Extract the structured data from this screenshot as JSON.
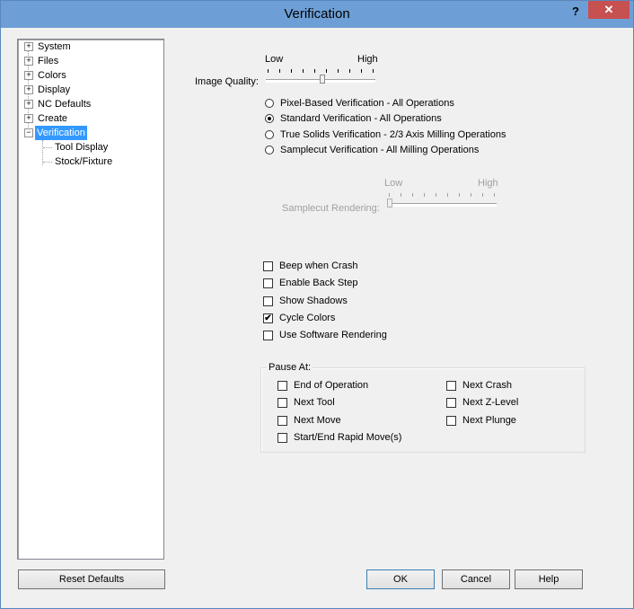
{
  "window": {
    "title": "Verification",
    "help_symbol": "?",
    "close_symbol": "✕"
  },
  "tree": {
    "items": [
      {
        "label": "System",
        "expander": "+"
      },
      {
        "label": "Files",
        "expander": "+"
      },
      {
        "label": "Colors",
        "expander": "+"
      },
      {
        "label": "Display",
        "expander": "+"
      },
      {
        "label": "NC Defaults",
        "expander": "+"
      },
      {
        "label": "Create",
        "expander": "+"
      },
      {
        "label": "Verification",
        "expander": "−",
        "selected": true
      },
      {
        "label": "Tool Display"
      },
      {
        "label": "Stock/Fixture"
      }
    ]
  },
  "image_quality": {
    "label": "Image Quality:",
    "low": "Low",
    "high": "High",
    "level_fraction": 0.5
  },
  "verification_modes": [
    {
      "label": "Pixel-Based Verification - All Operations",
      "selected": false
    },
    {
      "label": "Standard Verification - All Operations",
      "selected": true
    },
    {
      "label": "True Solids Verification - 2/3 Axis Milling Operations",
      "selected": false
    },
    {
      "label": "Samplecut Verification - All Milling Operations",
      "selected": false
    }
  ],
  "samplecut_rendering": {
    "label": "Samplecut Rendering:",
    "low": "Low",
    "high": "High",
    "level_fraction": 0.0,
    "enabled": false
  },
  "options": [
    {
      "label": "Beep when Crash",
      "checked": false
    },
    {
      "label": "Enable Back Step",
      "checked": false
    },
    {
      "label": "Show Shadows",
      "checked": false
    },
    {
      "label": "Cycle Colors",
      "checked": true
    },
    {
      "label": "Use Software Rendering",
      "checked": false
    }
  ],
  "pause_at": {
    "title": "Pause At:",
    "left": [
      {
        "label": "End of Operation",
        "checked": false
      },
      {
        "label": "Next Tool",
        "checked": false
      },
      {
        "label": "Next Move",
        "checked": false
      },
      {
        "label": "Start/End Rapid Move(s)",
        "checked": false
      }
    ],
    "right": [
      {
        "label": "Next Crash",
        "checked": false
      },
      {
        "label": "Next Z-Level",
        "checked": false
      },
      {
        "label": "Next Plunge",
        "checked": false
      }
    ]
  },
  "buttons": {
    "reset": "Reset Defaults",
    "ok": "OK",
    "cancel": "Cancel",
    "help": "Help"
  },
  "check_mark": "✔"
}
